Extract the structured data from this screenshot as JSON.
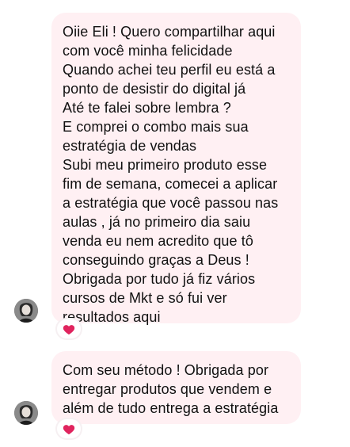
{
  "messages": [
    {
      "lines": [
        "Oiie Eli ! Quero compartilhar aqui",
        "com você minha felicidade",
        "Quando achei teu perfil eu está a",
        "ponto de desistir do digital já",
        "Até te falei sobre lembra ?",
        "E comprei o combo mais sua",
        "estratégia de vendas",
        "Subi meu primeiro produto esse",
        "fim de semana, comecei a aplicar",
        "a estratégia que você passou nas",
        "aulas , já no primeiro dia saiu",
        "venda eu nem acredito que tô",
        "conseguindo graças a Deus !",
        "Obrigada por tudo já fiz vários",
        "cursos de Mkt e só fui ver",
        "resultados aqui"
      ],
      "reaction": {
        "icon": "heart-icon",
        "color": "#e0245e"
      }
    },
    {
      "lines": [
        "Com seu método ! Obrigada por",
        "entregar produtos que vendem e",
        "além de tudo entrega a estratégia"
      ],
      "reaction": {
        "icon": "heart-icon",
        "color": "#e0245e"
      }
    }
  ],
  "colors": {
    "bubble": "#fff0f3",
    "text": "#111111",
    "heart": "#e0245e"
  }
}
